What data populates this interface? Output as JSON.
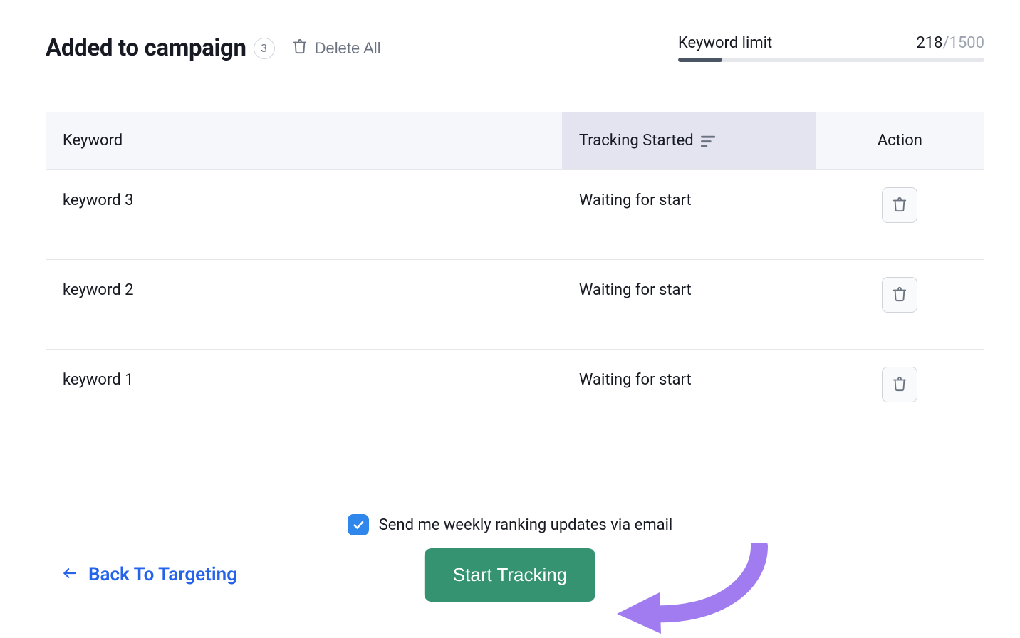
{
  "header": {
    "title": "Added to campaign",
    "count": "3",
    "delete_all_label": "Delete All"
  },
  "limit": {
    "label": "Keyword limit",
    "used": "218",
    "total": "1500",
    "fill_percent": 14.5
  },
  "table": {
    "columns": {
      "keyword": "Keyword",
      "tracking_started": "Tracking Started",
      "action": "Action"
    },
    "rows": [
      {
        "keyword": "keyword 3",
        "tracking_started": "Waiting for start"
      },
      {
        "keyword": "keyword 2",
        "tracking_started": "Waiting for start"
      },
      {
        "keyword": "keyword 1",
        "tracking_started": "Waiting for start"
      }
    ]
  },
  "footer": {
    "checkbox_label": "Send me weekly ranking updates via email",
    "checkbox_checked": true,
    "back_label": "Back To Targeting",
    "start_label": "Start Tracking"
  }
}
